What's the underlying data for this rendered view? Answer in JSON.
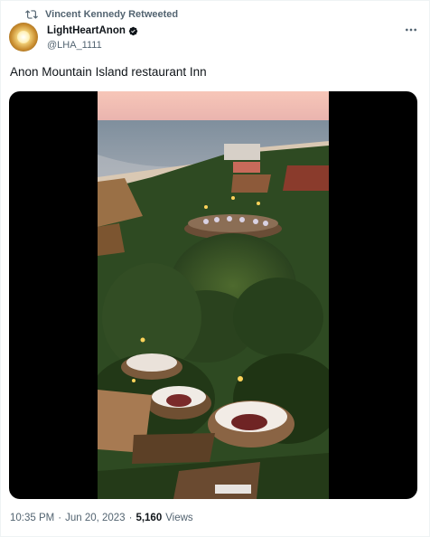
{
  "retweet": {
    "label": "Vincent Kennedy Retweeted",
    "icon": "retweet-icon"
  },
  "author": {
    "display_name": "LightHeartAnon",
    "handle": "@LHA_1111",
    "verified_icon": "verified-badge-icon",
    "avatar": "avatar-image"
  },
  "more_icon": "more-options-icon",
  "tweet": {
    "text": "Anon Mountain Island restaurant Inn"
  },
  "media": {
    "type": "video",
    "icon": "video-thumbnail"
  },
  "footer": {
    "time": "10:35 PM",
    "separator": "·",
    "date": "Jun 20, 2023",
    "separator2": "·",
    "views_count": "5,160",
    "views_label": "Views"
  },
  "colors": {
    "text_primary": "#0f1419",
    "text_secondary": "#536471",
    "media_background": "#000000",
    "accent": "#1d9bf0"
  }
}
